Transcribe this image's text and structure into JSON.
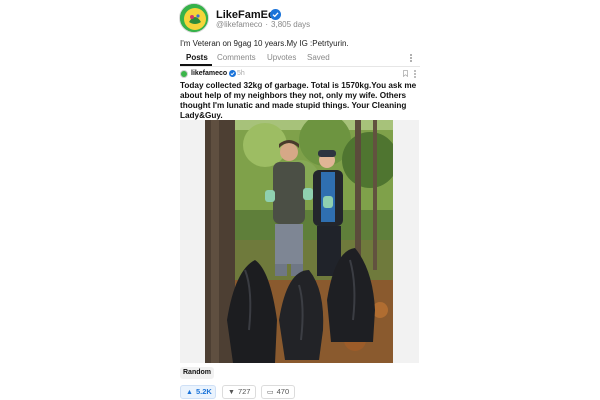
{
  "profile": {
    "username": "LikeFamEco",
    "handle": "@likefameco",
    "separator": "·",
    "account_age": "3,805 days",
    "bio": "I'm Veteran on 9gag 10 years.My IG :Petrtyurin.",
    "verified_icon": "verified-check-icon",
    "accent_color": "#1a73d9"
  },
  "tabs": [
    {
      "label": "Posts",
      "active": true
    },
    {
      "label": "Comments",
      "active": false
    },
    {
      "label": "Upvotes",
      "active": false
    },
    {
      "label": "Saved",
      "active": false
    }
  ],
  "post": {
    "author": "likefameco",
    "time": "5h",
    "title": "Today collected 32kg of garbage. Total is 1570kg.You ask me about help of my neighbors they not, only my wife. Others thought I'm lunatic and made stupid things. Your Cleaning Lady&Guy.",
    "tag": "Random",
    "actions": {
      "upvotes": "5.2K",
      "downvotes": "727",
      "comments": "470"
    }
  }
}
